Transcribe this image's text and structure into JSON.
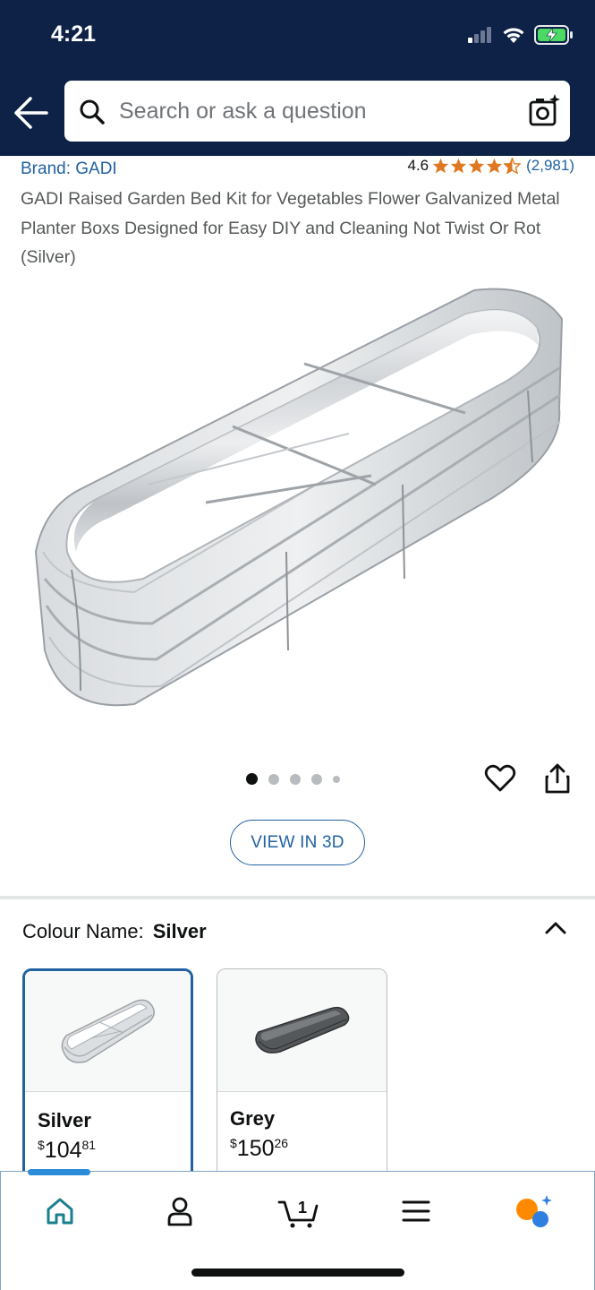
{
  "status_bar": {
    "time": "4:21"
  },
  "header": {
    "search_placeholder": "Search or ask a question"
  },
  "product": {
    "brand": "Brand: GADI",
    "rating": "4.6",
    "stars": 4.6,
    "rating_count": "(2,981)",
    "title": "GADI Raised Garden Bed Kit for Vegetables Flower Galvanized Metal Planter Boxs Designed for Easy DIY and Cleaning Not Twist Or Rot (Silver)",
    "image_count": 5,
    "active_image": 1,
    "view_3d_label": "VIEW IN 3D"
  },
  "colour": {
    "label": "Colour Name:",
    "selected": "Silver",
    "options": [
      {
        "name": "Silver",
        "currency": "$",
        "price_whole": "104",
        "price_cents": "81",
        "color": "#c9cccf"
      },
      {
        "name": "Grey",
        "currency": "$",
        "price_whole": "150",
        "price_cents": "26",
        "color": "#4a4c4e"
      }
    ]
  },
  "nav": {
    "items": [
      "home-icon",
      "account-icon",
      "cart-icon",
      "menu-icon",
      "rufus-icon"
    ],
    "cart_count": "1"
  },
  "colors": {
    "header_bg": "#0d2246",
    "link": "#2162a1",
    "star": "#de7921",
    "home_active": "#1a7f8e",
    "assistant_orange": "#ff8a00",
    "assistant_blue": "#2e7fe0"
  }
}
